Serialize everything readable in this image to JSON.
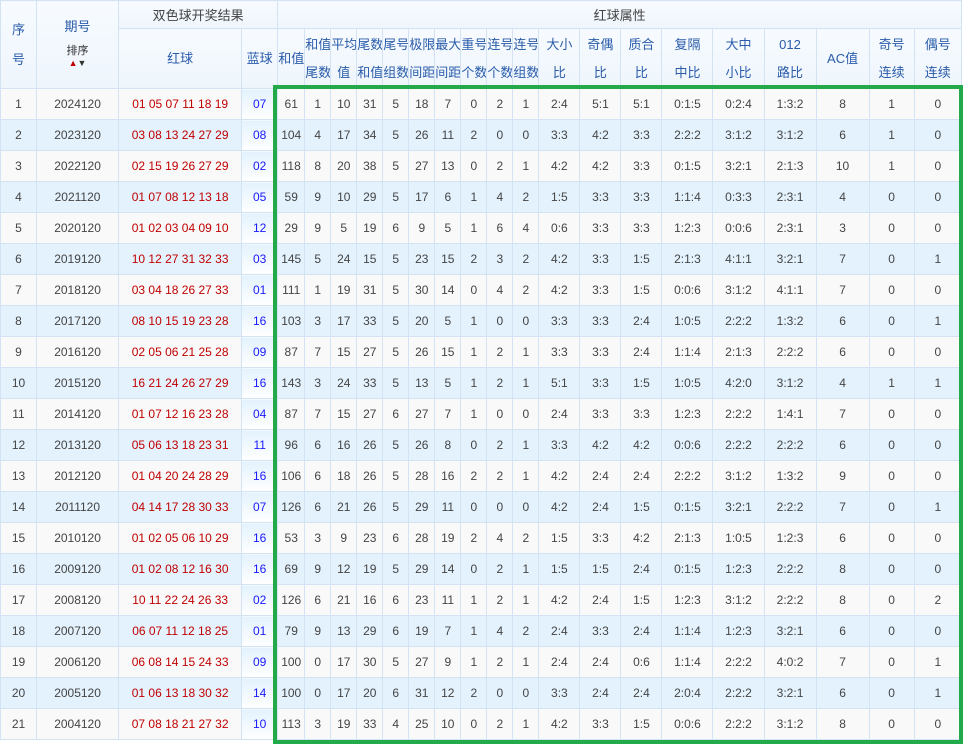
{
  "header": {
    "seq": [
      "序",
      "号"
    ],
    "issue": "期号",
    "sort_label": "排序",
    "sort_up": "▲",
    "sort_down": "▼",
    "result_group": "双色球开奖结果",
    "attr_group": "红球属性",
    "red": "红球",
    "blue": "蓝球",
    "attrs": [
      [
        "和值"
      ],
      [
        "和值",
        "尾数"
      ],
      [
        "平均",
        "值"
      ],
      [
        "尾数",
        "和值"
      ],
      [
        "尾号",
        "组数"
      ],
      [
        "极限",
        "间距"
      ],
      [
        "最大",
        "间距"
      ],
      [
        "重号",
        "个数"
      ],
      [
        "连号",
        "个数"
      ],
      [
        "连号",
        "组数"
      ],
      [
        "大小",
        "比"
      ],
      [
        "奇偶",
        "比"
      ],
      [
        "质合",
        "比"
      ],
      [
        "复隔",
        "中比"
      ],
      [
        "大中",
        "小比"
      ],
      [
        "012",
        "路比"
      ],
      [
        "AC值"
      ],
      [
        "奇号",
        "连续"
      ],
      [
        "偶号",
        "连续"
      ]
    ]
  },
  "colors": {
    "red_ball": "#c00000",
    "blue_ball": "#1a1aff",
    "highlight": "#22aa4a"
  },
  "rows": [
    [
      "1",
      "2024120",
      "01 05 07 11 18 19",
      "07",
      "61",
      "1",
      "10",
      "31",
      "5",
      "18",
      "7",
      "0",
      "2",
      "1",
      "2:4",
      "5:1",
      "5:1",
      "0:1:5",
      "0:2:4",
      "1:3:2",
      "8",
      "1",
      "0"
    ],
    [
      "2",
      "2023120",
      "03 08 13 24 27 29",
      "08",
      "104",
      "4",
      "17",
      "34",
      "5",
      "26",
      "11",
      "2",
      "0",
      "0",
      "3:3",
      "4:2",
      "3:3",
      "2:2:2",
      "3:1:2",
      "3:1:2",
      "6",
      "1",
      "0"
    ],
    [
      "3",
      "2022120",
      "02 15 19 26 27 29",
      "02",
      "118",
      "8",
      "20",
      "38",
      "5",
      "27",
      "13",
      "0",
      "2",
      "1",
      "4:2",
      "4:2",
      "3:3",
      "0:1:5",
      "3:2:1",
      "2:1:3",
      "10",
      "1",
      "0"
    ],
    [
      "4",
      "2021120",
      "01 07 08 12 13 18",
      "05",
      "59",
      "9",
      "10",
      "29",
      "5",
      "17",
      "6",
      "1",
      "4",
      "2",
      "1:5",
      "3:3",
      "3:3",
      "1:1:4",
      "0:3:3",
      "2:3:1",
      "4",
      "0",
      "0"
    ],
    [
      "5",
      "2020120",
      "01 02 03 04 09 10",
      "12",
      "29",
      "9",
      "5",
      "19",
      "6",
      "9",
      "5",
      "1",
      "6",
      "4",
      "0:6",
      "3:3",
      "3:3",
      "1:2:3",
      "0:0:6",
      "2:3:1",
      "3",
      "0",
      "0"
    ],
    [
      "6",
      "2019120",
      "10 12 27 31 32 33",
      "03",
      "145",
      "5",
      "24",
      "15",
      "5",
      "23",
      "15",
      "2",
      "3",
      "2",
      "4:2",
      "3:3",
      "1:5",
      "2:1:3",
      "4:1:1",
      "3:2:1",
      "7",
      "0",
      "1"
    ],
    [
      "7",
      "2018120",
      "03 04 18 26 27 33",
      "01",
      "111",
      "1",
      "19",
      "31",
      "5",
      "30",
      "14",
      "0",
      "4",
      "2",
      "4:2",
      "3:3",
      "1:5",
      "0:0:6",
      "3:1:2",
      "4:1:1",
      "7",
      "0",
      "0"
    ],
    [
      "8",
      "2017120",
      "08 10 15 19 23 28",
      "16",
      "103",
      "3",
      "17",
      "33",
      "5",
      "20",
      "5",
      "1",
      "0",
      "0",
      "3:3",
      "3:3",
      "2:4",
      "1:0:5",
      "2:2:2",
      "1:3:2",
      "6",
      "0",
      "1"
    ],
    [
      "9",
      "2016120",
      "02 05 06 21 25 28",
      "09",
      "87",
      "7",
      "15",
      "27",
      "5",
      "26",
      "15",
      "1",
      "2",
      "1",
      "3:3",
      "3:3",
      "2:4",
      "1:1:4",
      "2:1:3",
      "2:2:2",
      "6",
      "0",
      "0"
    ],
    [
      "10",
      "2015120",
      "16 21 24 26 27 29",
      "16",
      "143",
      "3",
      "24",
      "33",
      "5",
      "13",
      "5",
      "1",
      "2",
      "1",
      "5:1",
      "3:3",
      "1:5",
      "1:0:5",
      "4:2:0",
      "3:1:2",
      "4",
      "1",
      "1"
    ],
    [
      "11",
      "2014120",
      "01 07 12 16 23 28",
      "04",
      "87",
      "7",
      "15",
      "27",
      "6",
      "27",
      "7",
      "1",
      "0",
      "0",
      "2:4",
      "3:3",
      "3:3",
      "1:2:3",
      "2:2:2",
      "1:4:1",
      "7",
      "0",
      "0"
    ],
    [
      "12",
      "2013120",
      "05 06 13 18 23 31",
      "11",
      "96",
      "6",
      "16",
      "26",
      "5",
      "26",
      "8",
      "0",
      "2",
      "1",
      "3:3",
      "4:2",
      "4:2",
      "0:0:6",
      "2:2:2",
      "2:2:2",
      "6",
      "0",
      "0"
    ],
    [
      "13",
      "2012120",
      "01 04 20 24 28 29",
      "16",
      "106",
      "6",
      "18",
      "26",
      "5",
      "28",
      "16",
      "2",
      "2",
      "1",
      "4:2",
      "2:4",
      "2:4",
      "2:2:2",
      "3:1:2",
      "1:3:2",
      "9",
      "0",
      "0"
    ],
    [
      "14",
      "2011120",
      "04 14 17 28 30 33",
      "07",
      "126",
      "6",
      "21",
      "26",
      "5",
      "29",
      "11",
      "0",
      "0",
      "0",
      "4:2",
      "2:4",
      "1:5",
      "0:1:5",
      "3:2:1",
      "2:2:2",
      "7",
      "0",
      "1"
    ],
    [
      "15",
      "2010120",
      "01 02 05 06 10 29",
      "16",
      "53",
      "3",
      "9",
      "23",
      "6",
      "28",
      "19",
      "2",
      "4",
      "2",
      "1:5",
      "3:3",
      "4:2",
      "2:1:3",
      "1:0:5",
      "1:2:3",
      "6",
      "0",
      "0"
    ],
    [
      "16",
      "2009120",
      "01 02 08 12 16 30",
      "16",
      "69",
      "9",
      "12",
      "19",
      "5",
      "29",
      "14",
      "0",
      "2",
      "1",
      "1:5",
      "1:5",
      "2:4",
      "0:1:5",
      "1:2:3",
      "2:2:2",
      "8",
      "0",
      "0"
    ],
    [
      "17",
      "2008120",
      "10 11 22 24 26 33",
      "02",
      "126",
      "6",
      "21",
      "16",
      "6",
      "23",
      "11",
      "1",
      "2",
      "1",
      "4:2",
      "2:4",
      "1:5",
      "1:2:3",
      "3:1:2",
      "2:2:2",
      "8",
      "0",
      "2"
    ],
    [
      "18",
      "2007120",
      "06 07 11 12 18 25",
      "01",
      "79",
      "9",
      "13",
      "29",
      "6",
      "19",
      "7",
      "1",
      "4",
      "2",
      "2:4",
      "3:3",
      "2:4",
      "1:1:4",
      "1:2:3",
      "3:2:1",
      "6",
      "0",
      "0"
    ],
    [
      "19",
      "2006120",
      "06 08 14 15 24 33",
      "09",
      "100",
      "0",
      "17",
      "30",
      "5",
      "27",
      "9",
      "1",
      "2",
      "1",
      "2:4",
      "2:4",
      "0:6",
      "1:1:4",
      "2:2:2",
      "4:0:2",
      "7",
      "0",
      "1"
    ],
    [
      "20",
      "2005120",
      "01 06 13 18 30 32",
      "14",
      "100",
      "0",
      "17",
      "20",
      "6",
      "31",
      "12",
      "2",
      "0",
      "0",
      "3:3",
      "2:4",
      "2:4",
      "2:0:4",
      "2:2:2",
      "3:2:1",
      "6",
      "0",
      "1"
    ],
    [
      "21",
      "2004120",
      "07 08 18 21 27 32",
      "10",
      "113",
      "3",
      "19",
      "33",
      "4",
      "25",
      "10",
      "0",
      "2",
      "1",
      "4:2",
      "3:3",
      "1:5",
      "0:0:6",
      "2:2:2",
      "3:1:2",
      "8",
      "0",
      "0"
    ]
  ]
}
